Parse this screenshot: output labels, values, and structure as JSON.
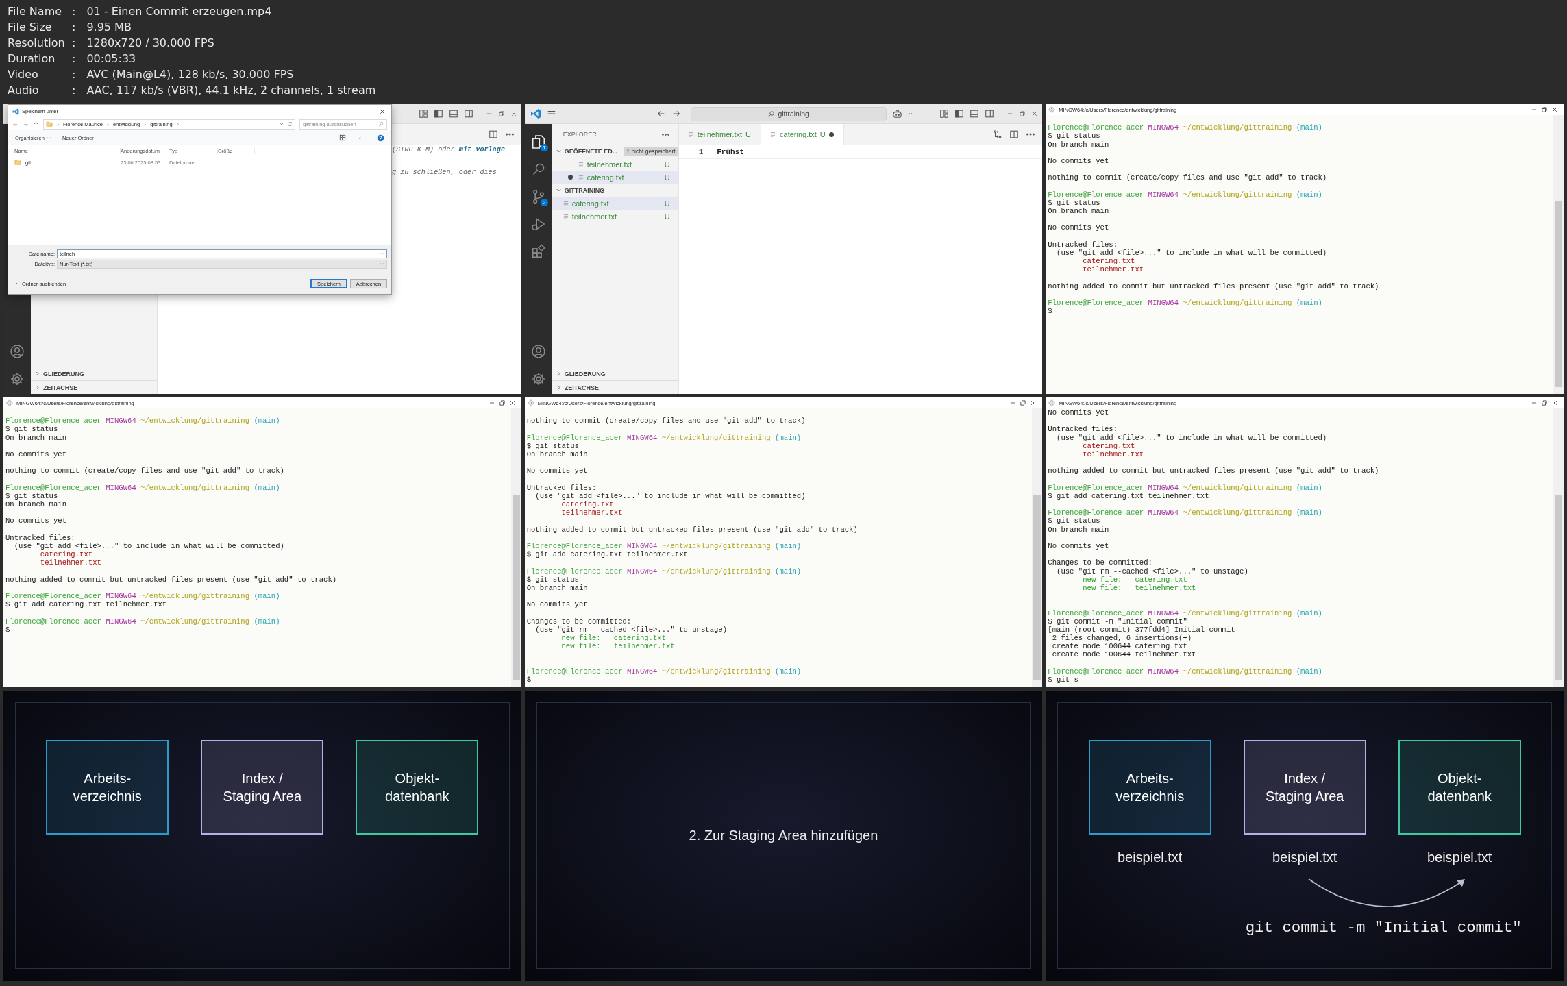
{
  "info": {
    "separator": ":",
    "rows": [
      {
        "label": "File Name",
        "value": "01 - Einen Commit erzeugen.mp4"
      },
      {
        "label": "File Size",
        "value": "9.95 MB"
      },
      {
        "label": "Resolution",
        "value": "1280x720 / 30.000 FPS"
      },
      {
        "label": "Duration",
        "value": "00:05:33"
      },
      {
        "label": "Video",
        "value": "AVC (Main@L4), 128 kb/s, 30.000 FPS"
      },
      {
        "label": "Audio",
        "value": "AAC, 117 kb/s (VBR), 44.1 kHz, 2 channels, 1 stream"
      }
    ]
  },
  "frames": [
    {
      "kind": "vscode",
      "sidebar": {
        "sections": [
          {
            "kind": "panel",
            "title": "GLIEDERUNG",
            "expanded": false
          },
          {
            "kind": "panel",
            "title": "ZEITACHSE",
            "expanded": false
          }
        ]
      },
      "editor_hints": [
        "(STRG+K M) oder **mit Vorlage**",
        "g zu schließen, oder dies"
      ],
      "dialog": {
        "title": "Speichern unter",
        "path": [
          "Florence Maurice",
          "entwicklung",
          "gittraining"
        ],
        "search": {
          "placeholder": "gittraining durchsuchen"
        },
        "organize": "Organisieren",
        "new_folder": "Neuer Ordner",
        "columns": [
          "Name",
          "Änderungsdatum",
          "Typ",
          "Größe"
        ],
        "rows": [
          {
            "name": ".git",
            "date": "23.06.2025 08:53",
            "type": "Dateiordner"
          }
        ],
        "filename_label": "Dateiname:",
        "filename": "teilneh",
        "filetype_label": "Dateityp:",
        "filetype": "Nur-Text (*.txt)",
        "toggle": "Ordner ausblenden",
        "buttons": [
          {
            "label": "Speichern",
            "default": true
          },
          {
            "label": "Abbrechen",
            "default": false
          }
        ]
      }
    },
    {
      "kind": "vscode",
      "search": "gittraining",
      "activity": [
        {
          "kind": "files",
          "badge": "1",
          "selected": true
        },
        {
          "kind": "search",
          "selected": false
        },
        {
          "kind": "source_control",
          "badge": "2",
          "selected": false
        },
        {
          "kind": "run",
          "selected": false
        },
        {
          "kind": "extensions",
          "selected": false
        }
      ],
      "sidebar": {
        "title": "EXPLORER",
        "sections": [
          {
            "kind": "editors",
            "title": "GEÖFFNETE ED...",
            "badge": "1 nicht gespeichert",
            "expanded": true,
            "items": [
              {
                "name": "teilnehmer.txt",
                "status": "U",
                "modified": false,
                "selected": false
              },
              {
                "name": "catering.txt",
                "status": "U",
                "modified": true,
                "selected": true
              }
            ]
          },
          {
            "kind": "folder",
            "title": "GITTRAINING",
            "expanded": true,
            "items": [
              {
                "name": "catering.txt",
                "status": "U",
                "modified": false,
                "selected": true
              },
              {
                "name": "teilnehmer.txt",
                "status": "U",
                "modified": false,
                "selected": false
              }
            ]
          },
          {
            "kind": "panel",
            "title": "GLIEDERUNG",
            "expanded": false
          },
          {
            "kind": "panel",
            "title": "ZEITACHSE",
            "expanded": false
          }
        ]
      },
      "tabs": [
        {
          "name": "teilnehmer.txt",
          "status": "U",
          "selected": false,
          "modified": false
        },
        {
          "name": "catering.txt",
          "status": "U",
          "selected": true,
          "modified": true
        }
      ],
      "editor_lines": [
        {
          "number": "1",
          "text": "Frühst"
        }
      ]
    },
    {
      "kind": "terminal",
      "title": "MINGW64:/c/Users/Florence/entwicklung/gittraining",
      "lines": [
        {
          "kind": "blank"
        },
        {
          "kind": "prompt",
          "user": "Florence@Florence_acer",
          "shell": "MINGW64",
          "path": "~/entwicklung/gittraining",
          "branch": "(main)"
        },
        {
          "kind": "text",
          "text": "$ git status"
        },
        {
          "kind": "text",
          "text": "On branch main"
        },
        {
          "kind": "blank"
        },
        {
          "kind": "text",
          "text": "No commits yet"
        },
        {
          "kind": "blank"
        },
        {
          "kind": "text",
          "text": "nothing to commit (create/copy files and use \"git add\" to track)"
        },
        {
          "kind": "blank"
        },
        {
          "kind": "prompt",
          "user": "Florence@Florence_acer",
          "shell": "MINGW64",
          "path": "~/entwicklung/gittraining",
          "branch": "(main)"
        },
        {
          "kind": "text",
          "text": "$ git status"
        },
        {
          "kind": "text",
          "text": "On branch main"
        },
        {
          "kind": "blank"
        },
        {
          "kind": "text",
          "text": "No commits yet"
        },
        {
          "kind": "blank"
        },
        {
          "kind": "text",
          "text": "Untracked files:"
        },
        {
          "kind": "hint",
          "text": "(use \"git add <file>...\" to include in what will be committed)"
        },
        {
          "kind": "untracked",
          "text": "catering.txt"
        },
        {
          "kind": "untracked",
          "text": "teilnehmer.txt"
        },
        {
          "kind": "blank"
        },
        {
          "kind": "text",
          "text": "nothing added to commit but untracked files present (use \"git add\" to track)"
        },
        {
          "kind": "blank"
        },
        {
          "kind": "prompt",
          "user": "Florence@Florence_acer",
          "shell": "MINGW64",
          "path": "~/entwicklung/gittraining",
          "branch": "(main)"
        },
        {
          "kind": "text",
          "text": "$"
        }
      ]
    },
    {
      "kind": "terminal",
      "title": "MINGW64:/c/Users/Florence/entwicklung/gittraining",
      "lines": [
        {
          "kind": "blank"
        },
        {
          "kind": "prompt",
          "user": "Florence@Florence_acer",
          "shell": "MINGW64",
          "path": "~/entwicklung/gittraining",
          "branch": "(main)"
        },
        {
          "kind": "text",
          "text": "$ git status"
        },
        {
          "kind": "text",
          "text": "On branch main"
        },
        {
          "kind": "blank"
        },
        {
          "kind": "text",
          "text": "No commits yet"
        },
        {
          "kind": "blank"
        },
        {
          "kind": "text",
          "text": "nothing to commit (create/copy files and use \"git add\" to track)"
        },
        {
          "kind": "blank"
        },
        {
          "kind": "prompt",
          "user": "Florence@Florence_acer",
          "shell": "MINGW64",
          "path": "~/entwicklung/gittraining",
          "branch": "(main)"
        },
        {
          "kind": "text",
          "text": "$ git status"
        },
        {
          "kind": "text",
          "text": "On branch main"
        },
        {
          "kind": "blank"
        },
        {
          "kind": "text",
          "text": "No commits yet"
        },
        {
          "kind": "blank"
        },
        {
          "kind": "text",
          "text": "Untracked files:"
        },
        {
          "kind": "hint",
          "text": "(use \"git add <file>...\" to include in what will be committed)"
        },
        {
          "kind": "untracked",
          "text": "catering.txt"
        },
        {
          "kind": "untracked",
          "text": "teilnehmer.txt"
        },
        {
          "kind": "blank"
        },
        {
          "kind": "text",
          "text": "nothing added to commit but untracked files present (use \"git add\" to track)"
        },
        {
          "kind": "blank"
        },
        {
          "kind": "prompt",
          "user": "Florence@Florence_acer",
          "shell": "MINGW64",
          "path": "~/entwicklung/gittraining",
          "branch": "(main)"
        },
        {
          "kind": "text",
          "text": "$ git add catering.txt teilnehmer.txt"
        },
        {
          "kind": "blank"
        },
        {
          "kind": "prompt",
          "user": "Florence@Florence_acer",
          "shell": "MINGW64",
          "path": "~/entwicklung/gittraining",
          "branch": "(main)"
        },
        {
          "kind": "text",
          "text": "$"
        }
      ]
    },
    {
      "kind": "terminal",
      "title": "MINGW64:/c/Users/Florence/entwicklung/gittraining",
      "lines": [
        {
          "kind": "blank"
        },
        {
          "kind": "text",
          "text": "nothing to commit (create/copy files and use \"git add\" to track)"
        },
        {
          "kind": "blank"
        },
        {
          "kind": "prompt",
          "user": "Florence@Florence_acer",
          "shell": "MINGW64",
          "path": "~/entwicklung/gittraining",
          "branch": "(main)"
        },
        {
          "kind": "text",
          "text": "$ git status"
        },
        {
          "kind": "text",
          "text": "On branch main"
        },
        {
          "kind": "blank"
        },
        {
          "kind": "text",
          "text": "No commits yet"
        },
        {
          "kind": "blank"
        },
        {
          "kind": "text",
          "text": "Untracked files:"
        },
        {
          "kind": "hint",
          "text": "(use \"git add <file>...\" to include in what will be committed)"
        },
        {
          "kind": "untracked",
          "text": "catering.txt"
        },
        {
          "kind": "untracked",
          "text": "teilnehmer.txt"
        },
        {
          "kind": "blank"
        },
        {
          "kind": "text",
          "text": "nothing added to commit but untracked files present (use \"git add\" to track)"
        },
        {
          "kind": "blank"
        },
        {
          "kind": "prompt",
          "user": "Florence@Florence_acer",
          "shell": "MINGW64",
          "path": "~/entwicklung/gittraining",
          "branch": "(main)"
        },
        {
          "kind": "text",
          "text": "$ git add catering.txt teilnehmer.txt"
        },
        {
          "kind": "blank"
        },
        {
          "kind": "prompt",
          "user": "Florence@Florence_acer",
          "shell": "MINGW64",
          "path": "~/entwicklung/gittraining",
          "branch": "(main)"
        },
        {
          "kind": "text",
          "text": "$ git status"
        },
        {
          "kind": "text",
          "text": "On branch main"
        },
        {
          "kind": "blank"
        },
        {
          "kind": "text",
          "text": "No commits yet"
        },
        {
          "kind": "blank"
        },
        {
          "kind": "text",
          "text": "Changes to be committed:"
        },
        {
          "kind": "hint",
          "text": "(use \"git rm --cached <file>...\" to unstage)"
        },
        {
          "kind": "staged",
          "text": "new file:   catering.txt"
        },
        {
          "kind": "staged",
          "text": "new file:   teilnehmer.txt"
        },
        {
          "kind": "blank"
        },
        {
          "kind": "blank"
        },
        {
          "kind": "prompt",
          "user": "Florence@Florence_acer",
          "shell": "MINGW64",
          "path": "~/entwicklung/gittraining",
          "branch": "(main)"
        },
        {
          "kind": "text",
          "text": "$"
        }
      ]
    },
    {
      "kind": "terminal",
      "title": "MINGW64:/c/Users/Florence/entwicklung/gittraining",
      "lines": [
        {
          "kind": "text",
          "text": "No commits yet"
        },
        {
          "kind": "blank"
        },
        {
          "kind": "text",
          "text": "Untracked files:"
        },
        {
          "kind": "hint",
          "text": "(use \"git add <file>...\" to include in what will be committed)"
        },
        {
          "kind": "untracked",
          "text": "catering.txt"
        },
        {
          "kind": "untracked",
          "text": "teilnehmer.txt"
        },
        {
          "kind": "blank"
        },
        {
          "kind": "text",
          "text": "nothing added to commit but untracked files present (use \"git add\" to track)"
        },
        {
          "kind": "blank"
        },
        {
          "kind": "prompt",
          "user": "Florence@Florence_acer",
          "shell": "MINGW64",
          "path": "~/entwicklung/gittraining",
          "branch": "(main)"
        },
        {
          "kind": "text",
          "text": "$ git add catering.txt teilnehmer.txt"
        },
        {
          "kind": "blank"
        },
        {
          "kind": "prompt",
          "user": "Florence@Florence_acer",
          "shell": "MINGW64",
          "path": "~/entwicklung/gittraining",
          "branch": "(main)"
        },
        {
          "kind": "text",
          "text": "$ git status"
        },
        {
          "kind": "text",
          "text": "On branch main"
        },
        {
          "kind": "blank"
        },
        {
          "kind": "text",
          "text": "No commits yet"
        },
        {
          "kind": "blank"
        },
        {
          "kind": "text",
          "text": "Changes to be committed:"
        },
        {
          "kind": "hint",
          "text": "(use \"git rm --cached <file>...\" to unstage)"
        },
        {
          "kind": "staged",
          "text": "new file:   catering.txt"
        },
        {
          "kind": "staged",
          "text": "new file:   teilnehmer.txt"
        },
        {
          "kind": "blank"
        },
        {
          "kind": "blank"
        },
        {
          "kind": "prompt",
          "user": "Florence@Florence_acer",
          "shell": "MINGW64",
          "path": "~/entwicklung/gittraining",
          "branch": "(main)"
        },
        {
          "kind": "text",
          "text": "$ git commit -m \"Initial commit\""
        },
        {
          "kind": "text",
          "text": "[main (root-commit) 377fdd4] Initial commit"
        },
        {
          "kind": "output",
          "text": "2 files changed, 6 insertions(+)"
        },
        {
          "kind": "output",
          "text": "create mode 100644 catering.txt"
        },
        {
          "kind": "output",
          "text": "create mode 100644 teilnehmer.txt"
        },
        {
          "kind": "blank"
        },
        {
          "kind": "prompt",
          "user": "Florence@Florence_acer",
          "shell": "MINGW64",
          "path": "~/entwicklung/gittraining",
          "branch": "(main)"
        },
        {
          "kind": "text",
          "text": "$ git s"
        }
      ]
    },
    {
      "kind": "slide",
      "boxes": [
        {
          "label": "Arbeits-\nverzeichnis",
          "color": "#2e9bc6"
        },
        {
          "label": "Index /\nStaging Area",
          "color": "#b5b0e6"
        },
        {
          "label": "Objekt-\ndatenbank",
          "color": "#3cc9a0"
        }
      ]
    },
    {
      "kind": "slide",
      "heading": "2. Zur Staging Area hinzufügen"
    },
    {
      "kind": "slide",
      "boxes": [
        {
          "label": "Arbeits-\nverzeichnis",
          "color": "#2e9bc6",
          "file": "beispiel.txt"
        },
        {
          "label": "Index /\nStaging Area",
          "color": "#b5b0e6",
          "file": "beispiel.txt"
        },
        {
          "label": "Objekt-\ndatenbank",
          "color": "#3cc9a0",
          "file": "beispiel.txt"
        }
      ],
      "command": "git commit -m \"Initial commit\""
    }
  ]
}
